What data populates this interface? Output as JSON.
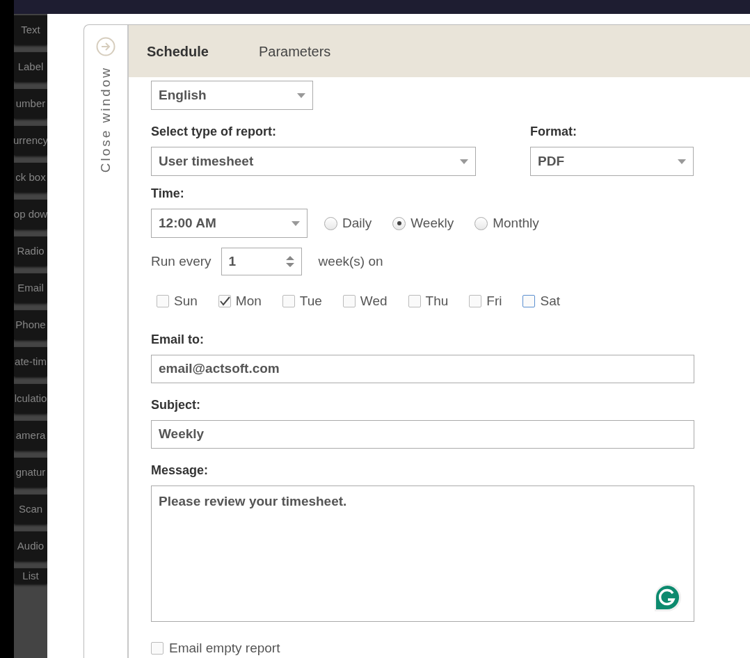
{
  "sidebar": {
    "items": [
      {
        "label": "Text"
      },
      {
        "label": "Label"
      },
      {
        "label": "umber"
      },
      {
        "label": "urrency"
      },
      {
        "label": "ck box"
      },
      {
        "label": "op dow"
      },
      {
        "label": "Radio"
      },
      {
        "label": "Email"
      },
      {
        "label": "Phone"
      },
      {
        "label": "ate-tim"
      },
      {
        "label": "lculatio"
      },
      {
        "label": "amera"
      },
      {
        "label": "gnatur"
      },
      {
        "label": "Scan"
      },
      {
        "label": "Audio"
      },
      {
        "label": "List"
      }
    ]
  },
  "close_tab": {
    "label": "Close window"
  },
  "tabs": [
    {
      "label": "Schedule",
      "selected": true
    },
    {
      "label": "Parameters",
      "selected": false
    }
  ],
  "language": {
    "value": "English"
  },
  "report_type": {
    "label": "Select type of report:",
    "value": "User timesheet"
  },
  "format": {
    "label": "Format:",
    "value": "PDF"
  },
  "time": {
    "label": "Time:",
    "value": "12:00 AM"
  },
  "frequency": [
    {
      "label": "Daily",
      "selected": false
    },
    {
      "label": "Weekly",
      "selected": true
    },
    {
      "label": "Monthly",
      "selected": false
    }
  ],
  "run_every": {
    "label": "Run every",
    "value": "1",
    "unit": "week(s) on"
  },
  "days": [
    {
      "label": "Sun",
      "checked": false,
      "focused": false
    },
    {
      "label": "Mon",
      "checked": true,
      "focused": false
    },
    {
      "label": "Tue",
      "checked": false,
      "focused": false
    },
    {
      "label": "Wed",
      "checked": false,
      "focused": false
    },
    {
      "label": "Thu",
      "checked": false,
      "focused": false
    },
    {
      "label": "Fri",
      "checked": false,
      "focused": false
    },
    {
      "label": "Sat",
      "checked": false,
      "focused": true
    }
  ],
  "email_to": {
    "label": "Email to:",
    "value": "email@actsoft.com"
  },
  "subject": {
    "label": "Subject:",
    "value": "Weekly"
  },
  "message": {
    "label": "Message:",
    "value": "Please review your timesheet."
  },
  "email_empty_report": {
    "label": "Email empty report",
    "checked": false
  }
}
